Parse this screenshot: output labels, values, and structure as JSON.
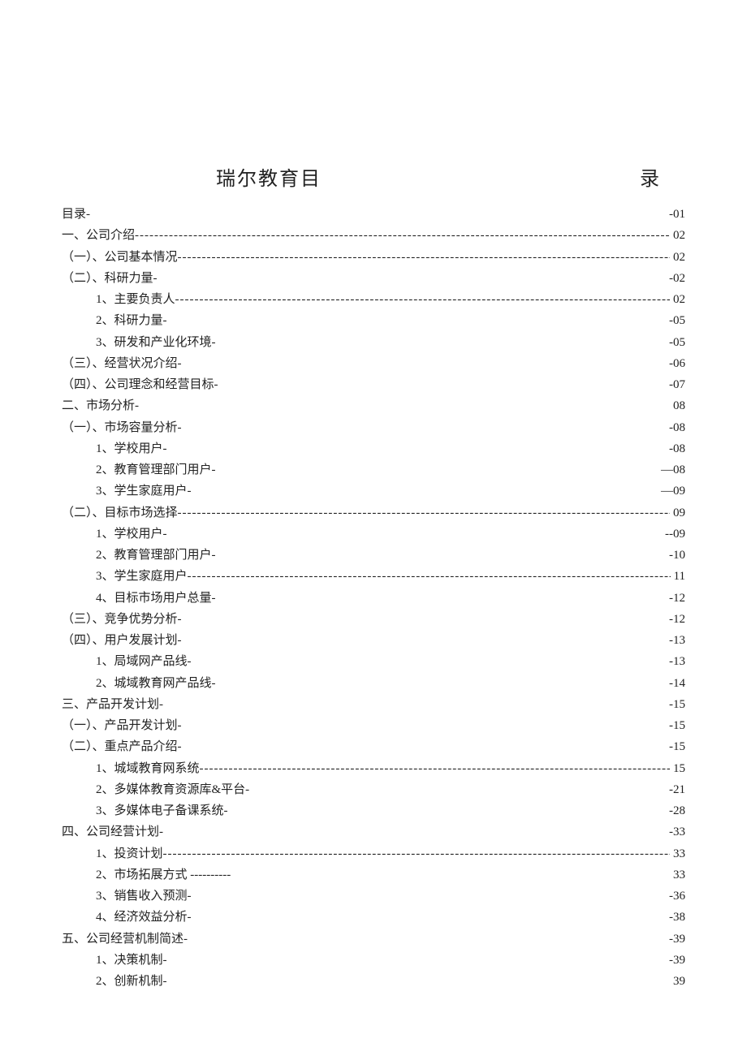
{
  "title_left": "瑞尔教育目",
  "title_right": "录",
  "entries": [
    {
      "label": "目录-",
      "page": "-01",
      "indent": 0,
      "leader": "none"
    },
    {
      "label": "一、公司介绍",
      "page": "02",
      "indent": 0,
      "leader": "dashes"
    },
    {
      "label": "（一）、公司基本情况",
      "page": "02",
      "indent": 1,
      "leader": "dashes"
    },
    {
      "label": "（二）、科研力量-",
      "page": "-02",
      "indent": 1,
      "leader": "none"
    },
    {
      "label": "1、主要负责人",
      "page": "02",
      "indent": 2,
      "leader": "dashes"
    },
    {
      "label": "2、科研力量-",
      "page": "-05",
      "indent": 2,
      "leader": "none"
    },
    {
      "label": "3、研发和产业化环境-",
      "page": "-05",
      "indent": 2,
      "leader": "none"
    },
    {
      "label": "（三）、经营状况介绍-",
      "page": "-06",
      "indent": 1,
      "leader": "none"
    },
    {
      "label": "（四）、公司理念和经营目标-",
      "page": "-07",
      "indent": 1,
      "leader": "none"
    },
    {
      "label": "二、市场分析-",
      "page": "08",
      "indent": 0,
      "leader": "none"
    },
    {
      "label": "（一）、市场容量分析-",
      "page": "-08",
      "indent": 1,
      "leader": "none"
    },
    {
      "label": "1、学校用户-",
      "page": "-08",
      "indent": 2,
      "leader": "none"
    },
    {
      "label": "2、教育管理部门用户-",
      "page": "—08",
      "indent": 2,
      "leader": "none"
    },
    {
      "label": "3、学生家庭用户-",
      "page": "—09",
      "indent": 2,
      "leader": "none"
    },
    {
      "label": "（二）、目标市场选择",
      "page": "09",
      "indent": 1,
      "leader": "dashes"
    },
    {
      "label": "1、学校用户-",
      "page": "--09",
      "indent": 2,
      "leader": "none"
    },
    {
      "label": "2、教育管理部门用户-",
      "page": "-10",
      "indent": 2,
      "leader": "none"
    },
    {
      "label": "3、学生家庭用户",
      "page": "11",
      "indent": 2,
      "leader": "dashes"
    },
    {
      "label": "4、目标市场用户总量-",
      "page": "-12",
      "indent": 2,
      "leader": "none"
    },
    {
      "label": "（三）、竞争优势分析-",
      "page": "-12",
      "indent": 1,
      "leader": "none"
    },
    {
      "label": "（四）、用户发展计划-",
      "page": "-13",
      "indent": 1,
      "leader": "none"
    },
    {
      "label": "1、局域网产品线-",
      "page": "-13",
      "indent": 2,
      "leader": "none"
    },
    {
      "label": "2、城域教育网产品线-",
      "page": "-14",
      "indent": 2,
      "leader": "none"
    },
    {
      "label": "三、产品开发计划-",
      "page": "-15",
      "indent": 0,
      "leader": "none"
    },
    {
      "label": "（一）、产品开发计划-",
      "page": "-15",
      "indent": 1,
      "leader": "none"
    },
    {
      "label": "（二）、重点产品介绍-",
      "page": "-15",
      "indent": 1,
      "leader": "none"
    },
    {
      "label": "1、城域教育网系统",
      "page": "15",
      "indent": 2,
      "leader": "dashes"
    },
    {
      "label": "2、多媒体教育资源库&平台-",
      "page": "-21",
      "indent": 2,
      "leader": "none"
    },
    {
      "label": "3、多媒体电子备课系统-",
      "page": "-28",
      "indent": 2,
      "leader": "none"
    },
    {
      "label": "四、公司经营计划-",
      "page": "-33",
      "indent": 0,
      "leader": "none"
    },
    {
      "label": "1、投资计划",
      "page": "33",
      "indent": 2,
      "leader": "dashes"
    },
    {
      "label": "2、市场拓展方式 ----------",
      "page": "33",
      "indent": 2,
      "leader": "none"
    },
    {
      "label": "3、销售收入预测-",
      "page": "-36",
      "indent": 2,
      "leader": "none"
    },
    {
      "label": "4、经济效益分析-",
      "page": "-38",
      "indent": 2,
      "leader": "none"
    },
    {
      "label": "五、公司经营机制简述-",
      "page": "-39",
      "indent": 0,
      "leader": "none"
    },
    {
      "label": "1、决策机制-",
      "page": "-39",
      "indent": 2,
      "leader": "none"
    },
    {
      "label": "2、创新机制-",
      "page": "39",
      "indent": 2,
      "leader": "none"
    }
  ]
}
